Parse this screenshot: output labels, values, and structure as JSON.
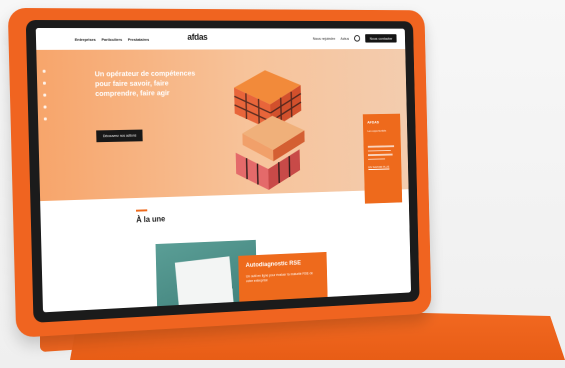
{
  "nav": {
    "links": [
      "Entreprises",
      "Particuliers",
      "Prestataires"
    ],
    "logo": "afdas",
    "logo_sub": "",
    "right_links": [
      "Nous rejoindre",
      "Actus"
    ],
    "contact_label": "Nous contacter"
  },
  "hero": {
    "title": "Un opérateur de compétences pour faire savoir, faire comprendre, faire agir",
    "cta_label": "Découvrez nos actions",
    "side_card": {
      "title": "AFDAS",
      "subtitle": "Les opportunités",
      "link": "EN SAVOIR PLUS"
    }
  },
  "section": {
    "title": "À la une"
  },
  "feature": {
    "title": "Autodiagnostic RSE",
    "description": "Un outil en ligne pour évaluer la maturité RSE de votre entreprise"
  },
  "colors": {
    "brand_orange": "#ee6a1c",
    "folio_orange": "#f06420",
    "hero_peach": "#f7c39a",
    "teal": "#4f918b"
  }
}
